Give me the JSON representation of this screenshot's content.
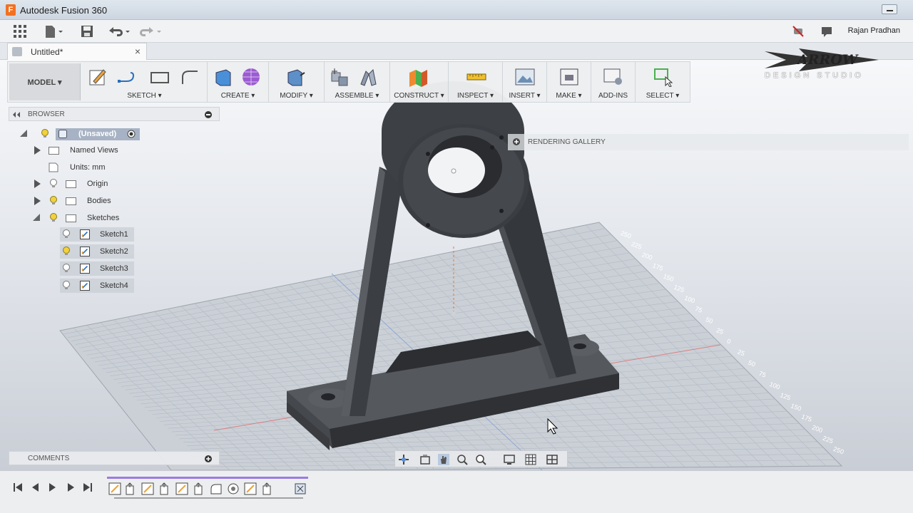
{
  "app": {
    "title": "Autodesk Fusion 360",
    "logo_letter": "F",
    "user": "Rajan Pradhan"
  },
  "document": {
    "tab_title": "Untitled*",
    "close_glyph": "×"
  },
  "ribbon": {
    "workspace": "MODEL ▾",
    "groups": [
      {
        "label": "SKETCH ▾"
      },
      {
        "label": "CREATE ▾"
      },
      {
        "label": "MODIFY ▾"
      },
      {
        "label": "ASSEMBLE ▾"
      },
      {
        "label": "CONSTRUCT ▾"
      },
      {
        "label": "INSPECT ▾"
      },
      {
        "label": "INSERT ▾"
      },
      {
        "label": "MAKE ▾"
      },
      {
        "label": "ADD-INS"
      },
      {
        "label": "SELECT ▾"
      }
    ]
  },
  "browser": {
    "title": "BROWSER",
    "root": "(Unsaved)",
    "items": [
      {
        "label": "Named Views"
      },
      {
        "label": "Units: mm"
      },
      {
        "label": "Origin"
      },
      {
        "label": "Bodies"
      },
      {
        "label": "Sketches"
      }
    ],
    "sketches": [
      "Sketch1",
      "Sketch2",
      "Sketch3",
      "Sketch4"
    ]
  },
  "rendering_gallery": "RENDERING GALLERY",
  "comments": "COMMENTS",
  "brand": {
    "word": "ARROW",
    "sub": "DESIGN STUDIO"
  },
  "grid_ticks": [
    "250",
    "225",
    "200",
    "175",
    "150",
    "125",
    "100",
    "75",
    "50",
    "25",
    "0",
    "25",
    "50",
    "75",
    "100",
    "125",
    "150",
    "175",
    "200",
    "225",
    "250"
  ],
  "colors": {
    "accent": "#f37021",
    "body": "#3a3d42",
    "grid": "#b9bec6"
  }
}
